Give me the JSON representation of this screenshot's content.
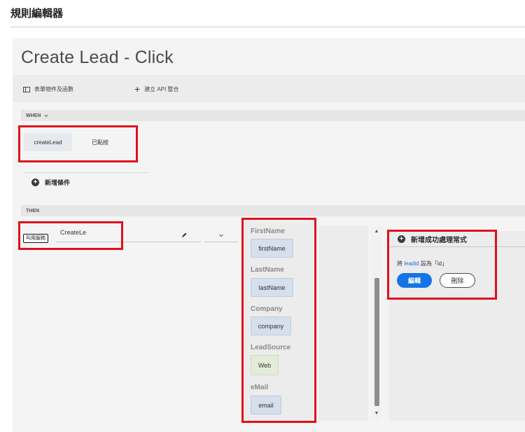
{
  "app": {
    "title": "規則編輯器"
  },
  "rule": {
    "title": "Create Lead - Click"
  },
  "toolbar": {
    "form_objects_label": "表單物件及函數",
    "create_api_label": "建立 API 整合"
  },
  "when": {
    "heading": "WHEN",
    "component": "createLead",
    "event": "已點按",
    "add_condition": "新增條件"
  },
  "then": {
    "heading": "THEN",
    "action_badge": "叫用服務",
    "service_value": "CreateLe"
  },
  "parameters": [
    {
      "label": "FirstName",
      "value": "firstName"
    },
    {
      "label": "LastName",
      "value": "lastName"
    },
    {
      "label": "Company",
      "value": "company"
    },
    {
      "label": "LeadSource",
      "value": "Web"
    },
    {
      "label": "eMail",
      "value": "email"
    }
  ],
  "success_handler": {
    "title": "新增成功處理常式",
    "text_prefix": "將",
    "text_keyword": "leadid",
    "text_suffix": "設為「id」",
    "edit_label": "編輯",
    "delete_label": "刪除"
  },
  "colors": {
    "highlight": "#e0111c",
    "primary": "#1473e6",
    "keyword": "#2b6fd6"
  },
  "icons": [
    "panel-icon",
    "plus-icon",
    "chevron-down-icon",
    "circle-plus-icon",
    "pencil-icon",
    "scroll-up-arrow-icon",
    "scroll-down-arrow-icon"
  ]
}
